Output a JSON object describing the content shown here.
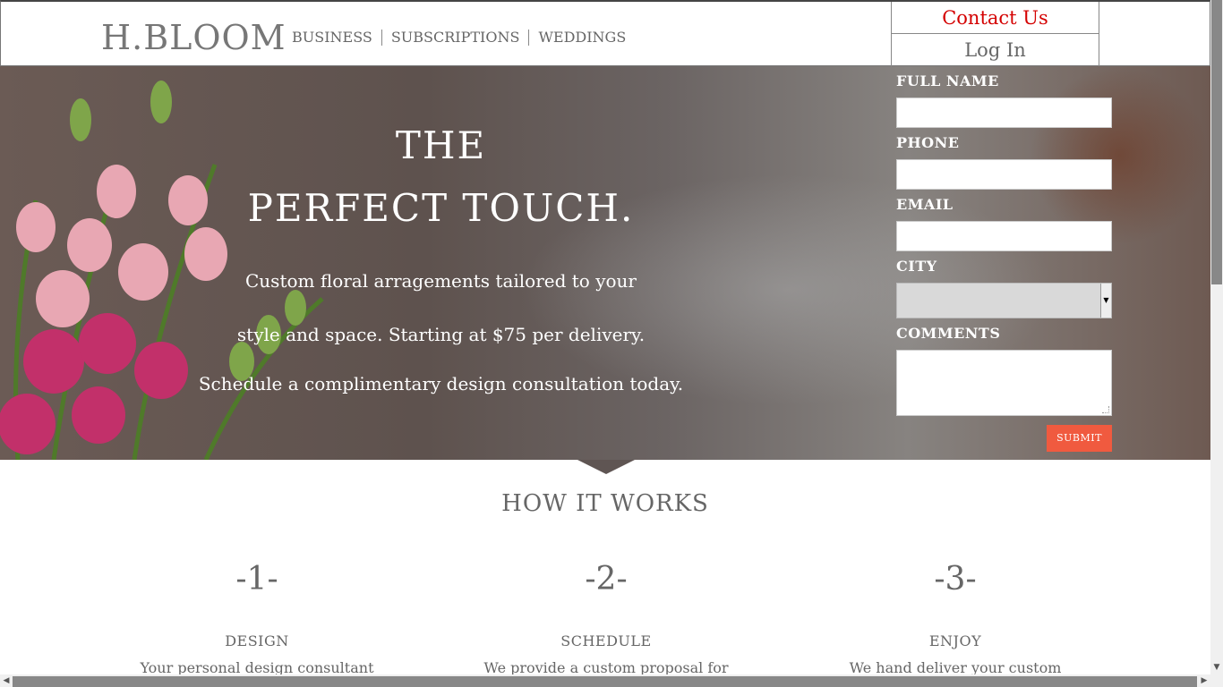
{
  "header": {
    "logo": "H.BLOOM",
    "nav": [
      "BUSINESS",
      "SUBSCRIPTIONS",
      "WEDDINGS"
    ],
    "contact_us": "Contact Us",
    "log_in": "Log In"
  },
  "hero": {
    "title_line1": "THE",
    "title_line2": "PERFECT TOUCH.",
    "line1": "Custom floral arragements tailored to your",
    "line2": "style and space. Starting at $75 per delivery.",
    "line3": "Schedule a complimentary design consultation today."
  },
  "form": {
    "full_name_label": "FULL NAME",
    "phone_label": "PHONE",
    "email_label": "EMAIL",
    "city_label": "CITY",
    "comments_label": "COMMENTS",
    "submit_label": "SUBMIT",
    "full_name_value": "",
    "phone_value": "",
    "email_value": "",
    "city_value": "",
    "comments_value": ""
  },
  "how_it_works": {
    "title": "HOW IT WORKS",
    "steps": [
      {
        "number": "-1-",
        "name": "DESIGN",
        "desc": "Your personal design consultant"
      },
      {
        "number": "-2-",
        "name": "SCHEDULE",
        "desc": "We provide a custom proposal for"
      },
      {
        "number": "-3-",
        "name": "ENJOY",
        "desc": "We hand deliver your custom"
      }
    ]
  },
  "colors": {
    "accent_red": "#d40000",
    "submit_bg": "#f05a3f",
    "text_gray": "#666666"
  },
  "icons": {
    "select_arrow": "chevron-down-icon",
    "scroll_up": "arrow-up-icon",
    "scroll_down": "arrow-down-icon",
    "scroll_left": "arrow-left-icon",
    "scroll_right": "arrow-right-icon"
  }
}
